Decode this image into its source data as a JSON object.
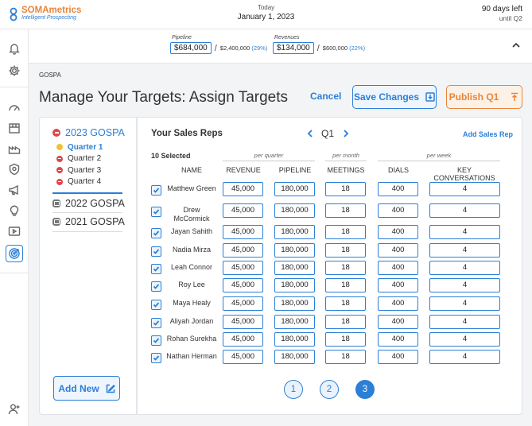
{
  "brand": {
    "name": "SOMAmetrics",
    "tagline": "Intelligent Prospecting"
  },
  "today": {
    "label": "Today",
    "date": "January 1, 2023"
  },
  "trial": {
    "days_left": "90 days left",
    "until": "until Q2"
  },
  "metrics": {
    "pipeline": {
      "label": "Pipeline",
      "value": "$684,000",
      "goal": "$2,400,000",
      "pct": "(29%)"
    },
    "revenues": {
      "label": "Revenues",
      "value": "$134,000",
      "goal": "$600,000",
      "pct": "(22%)"
    }
  },
  "page": {
    "breadcrumb": "GOSPA",
    "title": "Manage Your Targets: Assign Targets",
    "cancel": "Cancel",
    "save": "Save Changes",
    "publish": "Publish Q1"
  },
  "gospa": {
    "current": "2023 GOSPA",
    "quarters": [
      "Quarter 1",
      "Quarter 2",
      "Quarter 3",
      "Quarter 4"
    ],
    "archived": [
      "2022 GOSPA",
      "2021 GOSPA"
    ],
    "add_new": "Add New"
  },
  "reps": {
    "title": "Your Sales Reps",
    "quarter": "Q1",
    "add_rep": "Add Sales Rep",
    "selected": "10 Selected",
    "periods": {
      "quarter": "per quarter",
      "month": "per month",
      "week": "per week"
    },
    "columns": {
      "name": "NAME",
      "revenue": "REVENUE",
      "pipeline": "PIPELINE",
      "meetings": "MEETINGS",
      "dials": "DIALS",
      "conversations": "KEY CONVERSATIONS"
    },
    "rows": [
      {
        "name": "Matthew Green",
        "revenue": "45,000",
        "pipeline": "180,000",
        "meetings": "18",
        "dials": "400",
        "conversations": "4"
      },
      {
        "name": "Drew McCormick",
        "revenue": "45,000",
        "pipeline": "180,000",
        "meetings": "18",
        "dials": "400",
        "conversations": "4"
      },
      {
        "name": "Jayan Sahith",
        "revenue": "45,000",
        "pipeline": "180,000",
        "meetings": "18",
        "dials": "400",
        "conversations": "4"
      },
      {
        "name": "Nadia Mirza",
        "revenue": "45,000",
        "pipeline": "180,000",
        "meetings": "18",
        "dials": "400",
        "conversations": "4"
      },
      {
        "name": "Leah Connor",
        "revenue": "45,000",
        "pipeline": "180,000",
        "meetings": "18",
        "dials": "400",
        "conversations": "4"
      },
      {
        "name": "Roy Lee",
        "revenue": "45,000",
        "pipeline": "180,000",
        "meetings": "18",
        "dials": "400",
        "conversations": "4"
      },
      {
        "name": "Maya Healy",
        "revenue": "45,000",
        "pipeline": "180,000",
        "meetings": "18",
        "dials": "400",
        "conversations": "4"
      },
      {
        "name": "Aliyah Jordan",
        "revenue": "45,000",
        "pipeline": "180,000",
        "meetings": "18",
        "dials": "400",
        "conversations": "4"
      },
      {
        "name": "Rohan Surekha",
        "revenue": "45,000",
        "pipeline": "180,000",
        "meetings": "18",
        "dials": "400",
        "conversations": "4"
      },
      {
        "name": "Nathan Herman",
        "revenue": "45,000",
        "pipeline": "180,000",
        "meetings": "18",
        "dials": "400",
        "conversations": "4"
      }
    ],
    "pages": [
      "1",
      "2",
      "3"
    ],
    "active_page": "3"
  },
  "colors": {
    "accent": "#2b7fd6",
    "brand_orange": "#e8853a",
    "danger": "#e0474c",
    "warning": "#f1c232"
  },
  "icons": [
    "bell-icon",
    "gear-icon",
    "speedometer-icon",
    "package-icon",
    "factory-icon",
    "badge-icon",
    "megaphone-icon",
    "lightbulb-icon",
    "video-icon",
    "target-icon",
    "user-add-icon",
    "chevron-up-icon",
    "chevron-left-icon",
    "chevron-right-icon",
    "download-icon",
    "upload-icon",
    "edit-icon",
    "checkbox-icon"
  ]
}
